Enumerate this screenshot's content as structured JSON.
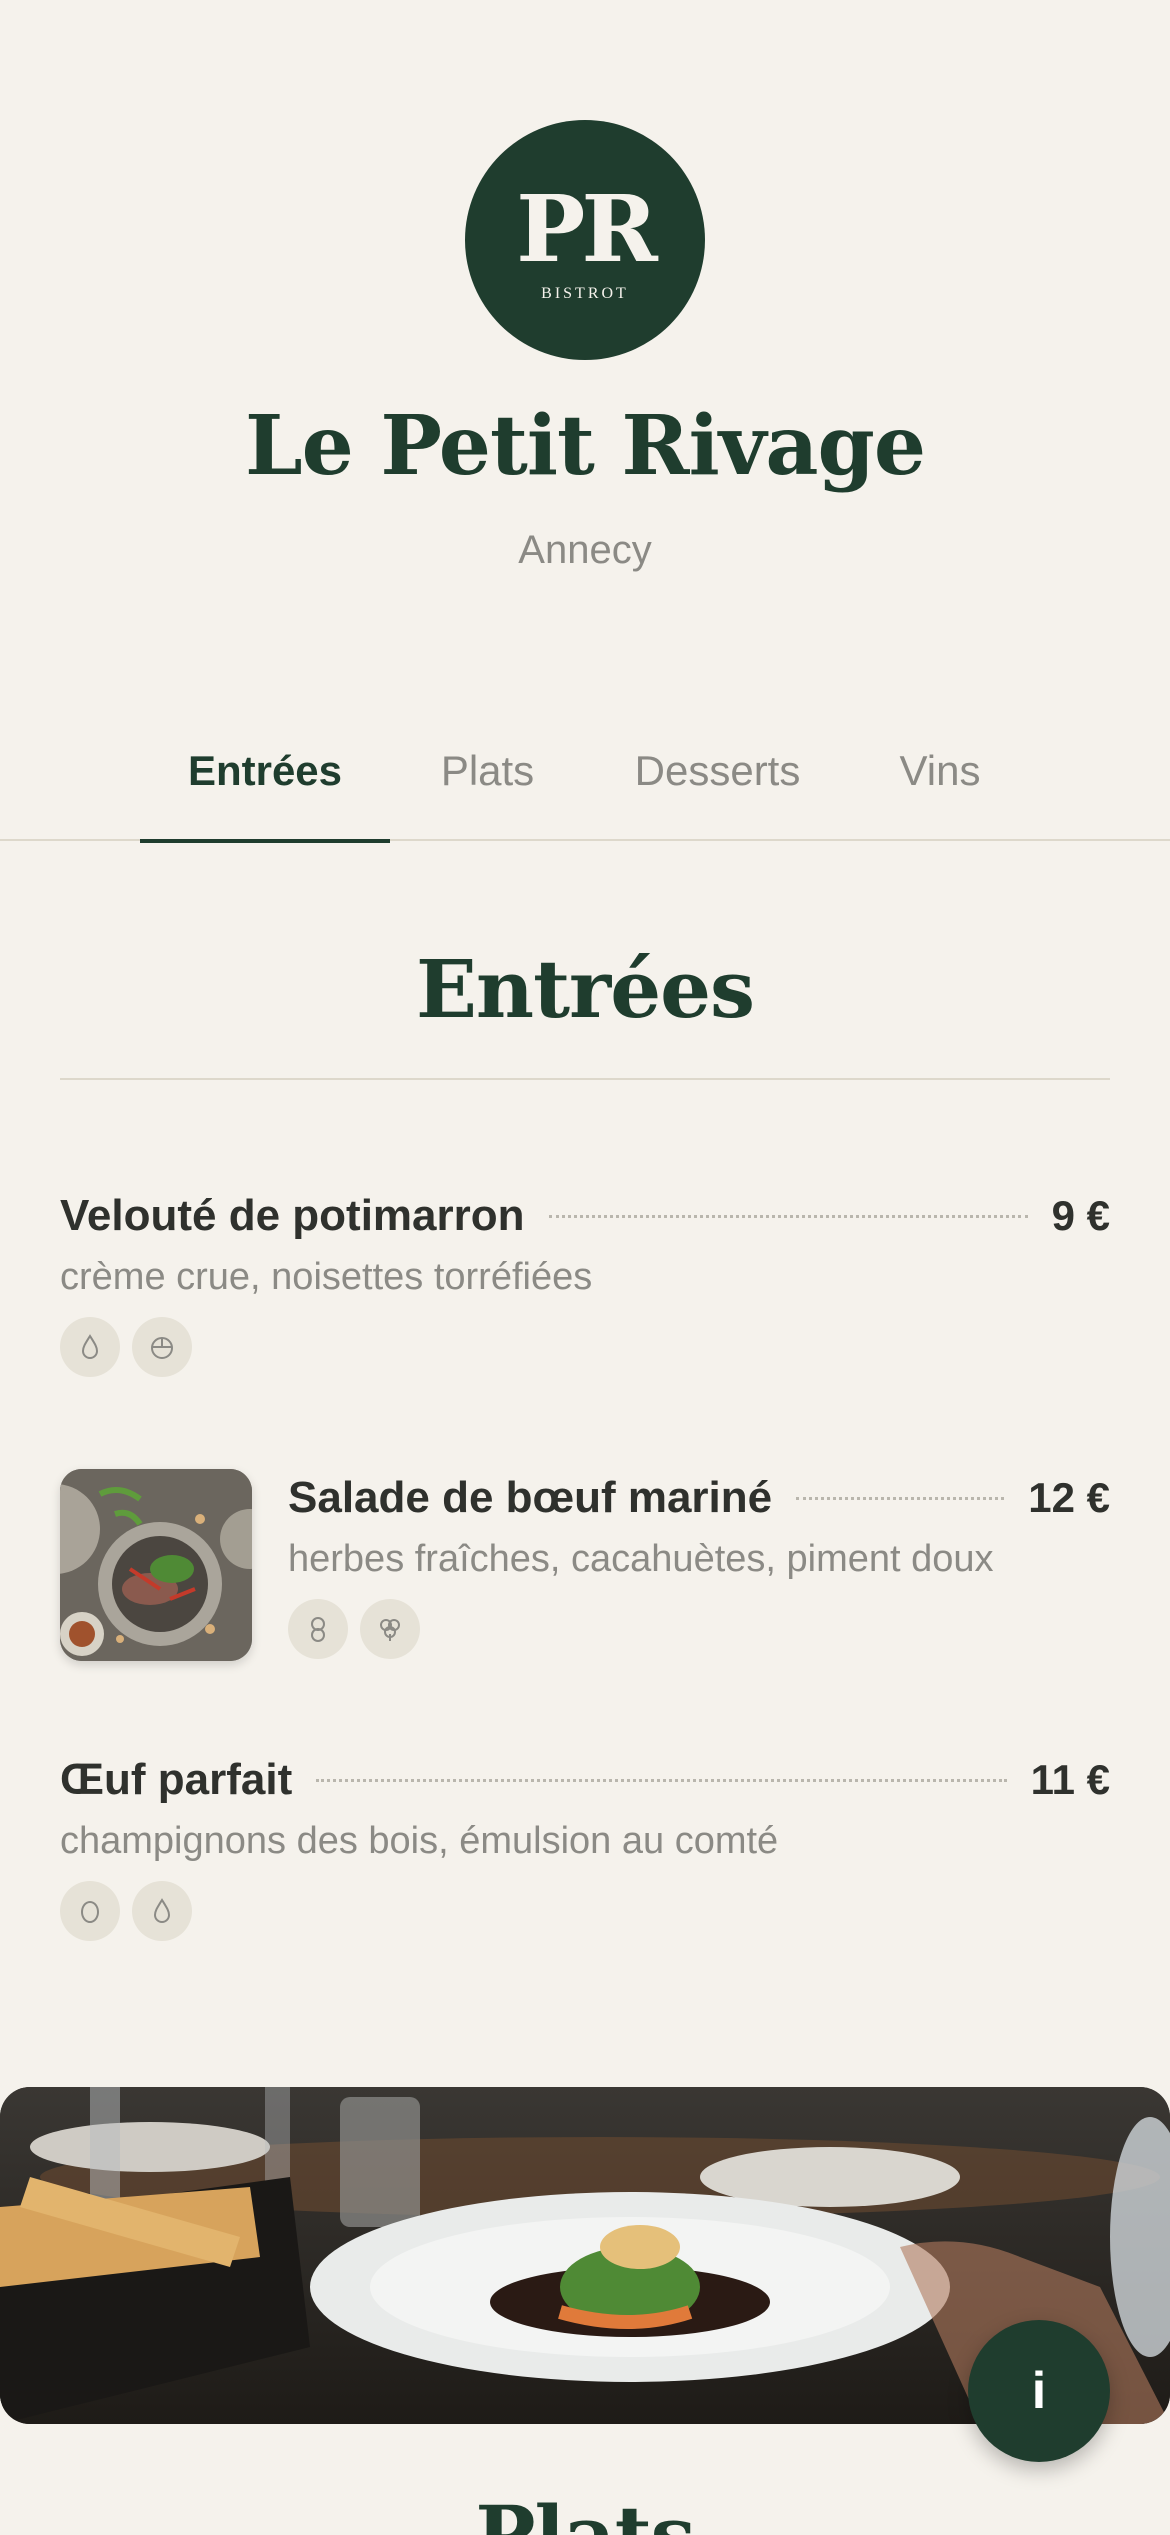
{
  "restaurant": {
    "logo_monogram": "PR",
    "logo_subtitle": "BISTROT",
    "name": "Le Petit Rivage",
    "city": "Annecy"
  },
  "tabs": [
    {
      "label": "Entrées",
      "active": true
    },
    {
      "label": "Plats",
      "active": false
    },
    {
      "label": "Desserts",
      "active": false
    },
    {
      "label": "Vins",
      "active": false
    }
  ],
  "section": {
    "title": "Entrées",
    "items": [
      {
        "name": "Velouté de potimarron",
        "price": "9 €",
        "description": "crème crue, noisettes torréfiées",
        "badges": [
          "drop-icon",
          "nut-icon"
        ]
      },
      {
        "name": "Salade de bœuf mariné",
        "price": "12 €",
        "description": "herbes fraîches, cacahuètes, piment doux",
        "badges": [
          "peanut-icon",
          "clover-icon"
        ],
        "image": "salad-photo"
      },
      {
        "name": "Œuf parfait",
        "price": "11 €",
        "description": "champignons des bois, émulsion au comté",
        "badges": [
          "egg-icon",
          "drop-icon"
        ]
      }
    ]
  },
  "banner": "restaurant-table-photo",
  "info_button_label": "i",
  "next_section_title": "Plats",
  "colors": {
    "background": "#f5f2ec",
    "brand_green": "#1f3d2e",
    "muted_text": "#8b8a85",
    "badge_bg": "#e6e2d7"
  }
}
